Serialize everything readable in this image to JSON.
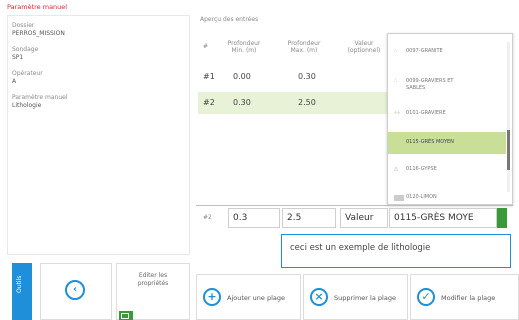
{
  "header": {
    "title": "Paramètre manuel"
  },
  "left_panel": {
    "fields": [
      {
        "label": "Dossier",
        "value": "PERROS_MISSION"
      },
      {
        "label": "Sondage",
        "value": "SP1"
      },
      {
        "label": "Opérateur",
        "value": "A"
      },
      {
        "label": "Paramètre manuel",
        "value": "Lithologie"
      }
    ]
  },
  "bottom_left": {
    "tools_label": "Outils",
    "back_icon": "chevron-left-icon",
    "edit_label_1": "Editer les",
    "edit_label_2": "propriétés"
  },
  "preview": {
    "title": "Aperçu des entrées",
    "columns": [
      "#",
      "Profondeur Min. (m)",
      "Profondeur Max. (m)",
      "Valeur (optionnel)"
    ],
    "rows": [
      {
        "idx": "#1",
        "min": "0.00",
        "max": "0.30",
        "selected": false
      },
      {
        "idx": "#2",
        "min": "0.30",
        "max": "2.50",
        "selected": true
      }
    ]
  },
  "dropdown": {
    "items": [
      {
        "icon": "gravel-icon",
        "label": "0097-GRANITE"
      },
      {
        "icon": "gravel-icon",
        "label": "0099-GRAVIERS ET SABLES"
      },
      {
        "icon": "gravel-icon",
        "label": "0101-GRAVIERE"
      },
      {
        "icon": "",
        "label": "0115-GRÈS MOYEN",
        "selected": true
      },
      {
        "icon": "triangle-icon",
        "label": "0116-GYPSE"
      },
      {
        "icon": "gray-box-icon",
        "label": "0120-LIMON"
      }
    ]
  },
  "editor": {
    "idx": "#2",
    "min": "0.3",
    "max": "2.5",
    "value_placeholder": "Valeur",
    "lithology": "0115-GRÈS MOYE",
    "description": "ceci est un exemple de lithologie"
  },
  "actions": {
    "add": "Ajouter une plage",
    "delete": "Supprimer la plage",
    "modify": "Modifier la plage"
  },
  "colors": {
    "accent": "#1e8fd8",
    "selection": "#e8f2d6",
    "dropdown_selection": "#c9df98",
    "green": "#3a9a3a",
    "title_red": "#d9262c"
  }
}
